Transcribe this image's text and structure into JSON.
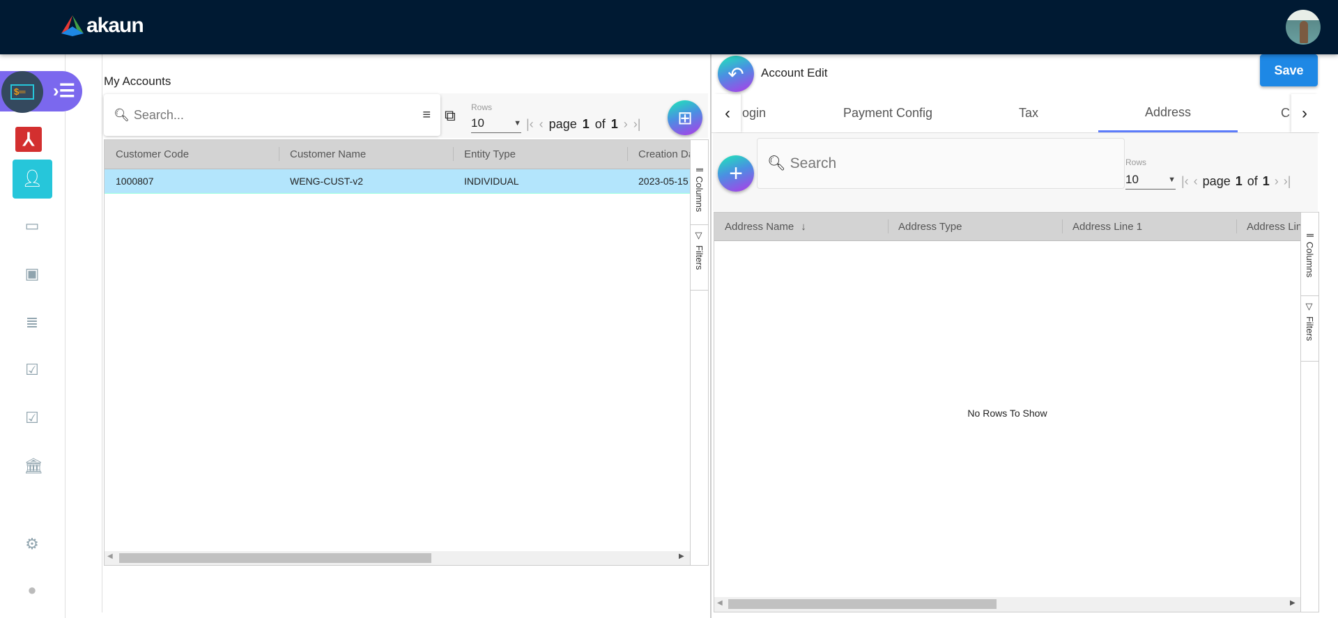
{
  "header": {
    "brand": "akaun",
    "avatar": "user-avatar"
  },
  "sidebar": {
    "items": [
      "accounting-app",
      "pdf-app",
      "customer",
      "card",
      "monitor",
      "receipt",
      "checklist-1",
      "checklist-2",
      "bank",
      "settings",
      "profile"
    ]
  },
  "left": {
    "title": "My Accounts",
    "search_placeholder": "Search...",
    "rows_label": "Rows",
    "rows_value": "10",
    "pager": {
      "page_label": "page",
      "page": "1",
      "of_label": "of",
      "total": "1"
    },
    "columns": [
      "Customer Code",
      "Customer Name",
      "Entity Type",
      "Creation Da"
    ],
    "rows": [
      [
        "1000807",
        "WENG-CUST-v2",
        "INDIVIDUAL",
        "2023-05-15"
      ]
    ],
    "side_tabs": [
      "Columns",
      "Filters"
    ]
  },
  "right": {
    "title": "Account Edit",
    "save_label": "Save",
    "tabs": [
      "ogin",
      "Payment Config",
      "Tax",
      "Address",
      "C"
    ],
    "active_tab": "Address",
    "search_placeholder": "Search",
    "rows_label": "Rows",
    "rows_value": "10",
    "pager": {
      "page_label": "page",
      "page": "1",
      "of_label": "of",
      "total": "1"
    },
    "columns": [
      "Address Name",
      "Address Type",
      "Address Line 1",
      "Address Lin"
    ],
    "empty_text": "No Rows To Show",
    "side_tabs": [
      "Columns",
      "Filters"
    ]
  },
  "colors": {
    "header": "#001a33",
    "accent": "#7b68ee",
    "selected_row": "#b3e5fc",
    "save": "#1e88e5"
  }
}
